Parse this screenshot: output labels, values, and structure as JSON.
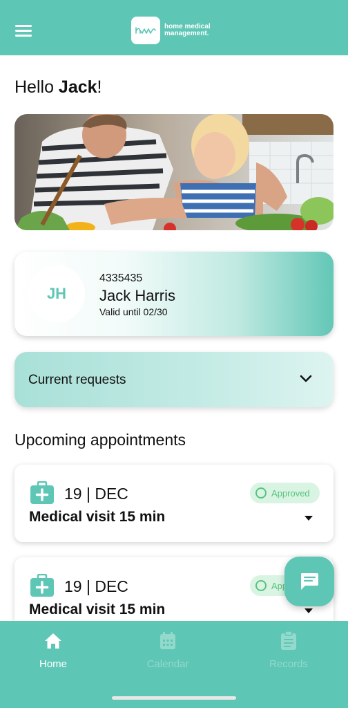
{
  "header": {
    "logo_text": "home medical management.",
    "brand_color": "#5ec6b5"
  },
  "greeting": {
    "prefix": "Hello ",
    "name": "Jack",
    "suffix": "!"
  },
  "member": {
    "initials": "JH",
    "id": "4335435",
    "name": "Jack Harris",
    "valid": "Valid until 02/30"
  },
  "requests": {
    "label": "Current requests"
  },
  "appointments": {
    "title": "Upcoming appointments",
    "items": [
      {
        "date": "19 | DEC",
        "title": "Medical visit 15 min",
        "status": "Approved"
      },
      {
        "date": "19 | DEC",
        "title": "Medical visit 15 min",
        "status": "Approved"
      }
    ]
  },
  "nav": {
    "items": [
      {
        "label": "Home",
        "icon": "home-icon",
        "active": true
      },
      {
        "label": "Calendar",
        "icon": "calendar-icon",
        "active": false
      },
      {
        "label": "Records",
        "icon": "clipboard-icon",
        "active": false
      }
    ]
  },
  "colors": {
    "accent": "#5ec6b5",
    "approved": "#58c281",
    "approved_bg": "#d9f4e2"
  }
}
